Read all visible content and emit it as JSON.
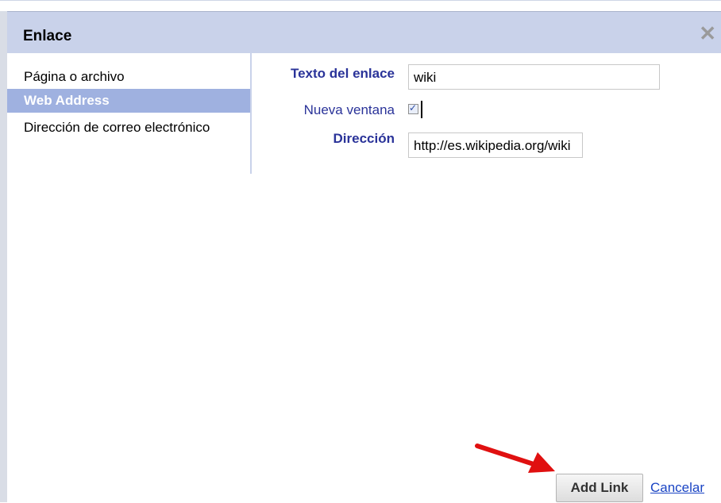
{
  "dialog": {
    "title": "Enlace",
    "close_icon": "close-icon"
  },
  "sidebar": {
    "items": [
      {
        "label": "Página o archivo",
        "selected": false
      },
      {
        "label": "Web Address",
        "selected": true
      },
      {
        "label": "Dirección de correo electrónico",
        "selected": false
      }
    ]
  },
  "form": {
    "link_text_label": "Texto del enlace",
    "link_text_value": "wiki",
    "new_window_label": "Nueva ventana",
    "new_window_checked": true,
    "address_label": "Dirección",
    "address_value": "http://es.wikipedia.org/wiki"
  },
  "buttons": {
    "add_link": "Add Link",
    "cancel": "Cancelar"
  },
  "colors": {
    "title_bar": "#c9d2ea",
    "selected_item": "#9fb1e0",
    "label_text": "#2a3399",
    "link": "#1a44c4",
    "arrow": "#e01010"
  }
}
